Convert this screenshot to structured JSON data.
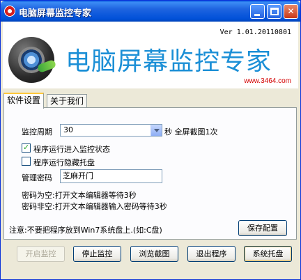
{
  "window": {
    "title": "电脑屏幕监控专家",
    "controls": {
      "minimize": "_",
      "maximize": "□",
      "close": "✕"
    }
  },
  "header": {
    "version": "Ver 1.01.20110801",
    "brand": "电脑屏幕监控专家",
    "site": "www.3464.com",
    "logo_icon": "camera-lens-icon"
  },
  "tabs": [
    {
      "label": "软件设置",
      "active": true
    },
    {
      "label": "关于我们",
      "active": false
    }
  ],
  "settings": {
    "interval_label": "监控周期",
    "interval_value": "30",
    "interval_suffix": "秒 全屏截图1次",
    "auto_monitor_label": "程序运行进入监控状态",
    "auto_monitor_checked": true,
    "hide_tray_label": "程序运行隐藏托盘",
    "hide_tray_checked": false,
    "password_label": "管理密码",
    "password_value": "芝麻开门",
    "hint_line1": "密码为空:打开文本编辑器等待3秒",
    "hint_line2": "密码非空:打开文本编辑器输入密码等待3秒",
    "note": "注意:不要把程序放到Win7系统盘上.(如:C盘)",
    "save_label": "保存配置"
  },
  "footer_buttons": [
    {
      "label": "开启监控",
      "enabled": false
    },
    {
      "label": "停止监控",
      "enabled": true
    },
    {
      "label": "浏览截图",
      "enabled": true
    },
    {
      "label": "退出程序",
      "enabled": true
    },
    {
      "label": "系统托盘",
      "enabled": true,
      "focused": true
    }
  ],
  "colors": {
    "titlebar": "#0058e6",
    "brand_text": "#1b8fd6",
    "site_text": "#d40000",
    "tab_highlight": "#ffc83c"
  }
}
